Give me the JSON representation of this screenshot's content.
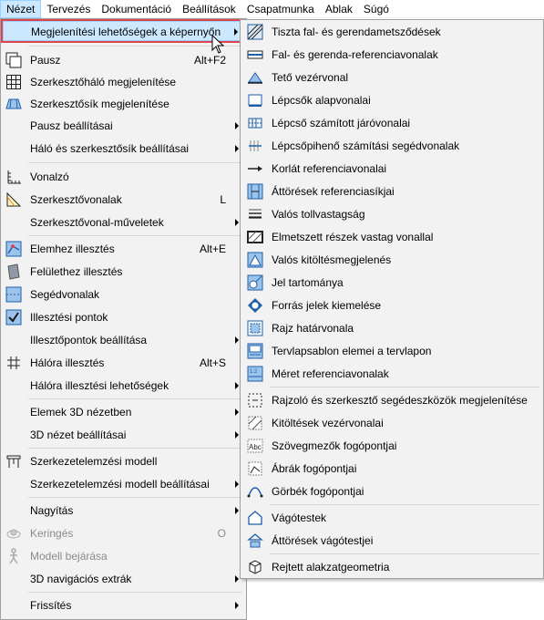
{
  "menubar": {
    "items": [
      "Nézet",
      "Tervezés",
      "Dokumentáció",
      "Beállítások",
      "Csapatmunka",
      "Ablak",
      "Súgó"
    ]
  },
  "left_menu": {
    "items": [
      {
        "label": "Megjelenítési lehetőségek a képernyőn",
        "shortcut": "",
        "submenu": true,
        "icon": "none",
        "state": "highlighted"
      },
      {
        "label": "Pausz",
        "shortcut": "Alt+F2",
        "submenu": false,
        "icon": "trace-icon"
      },
      {
        "label": "Szerkesztőháló megjelenítése",
        "shortcut": "",
        "submenu": false,
        "icon": "grid-icon"
      },
      {
        "label": "Szerkesztősík megjelenítése",
        "shortcut": "",
        "submenu": false,
        "icon": "editing-plane-icon"
      },
      {
        "label": "Pausz beállításai",
        "shortcut": "",
        "submenu": true,
        "icon": "none"
      },
      {
        "label": "Háló és szerkesztősík beállításai",
        "shortcut": "",
        "submenu": true,
        "icon": "none"
      },
      {
        "label": "Vonalzó",
        "shortcut": "",
        "submenu": false,
        "icon": "ruler-icon"
      },
      {
        "label": "Szerkesztővonalak",
        "shortcut": "L",
        "submenu": false,
        "icon": "guide-lines-icon"
      },
      {
        "label": "Szerkesztővonal-műveletek",
        "shortcut": "",
        "submenu": true,
        "icon": "none"
      },
      {
        "label": "Elemhez illesztés",
        "shortcut": "Alt+E",
        "submenu": false,
        "icon": "snap-element-icon"
      },
      {
        "label": "Felülethez illesztés",
        "shortcut": "",
        "submenu": false,
        "icon": "snap-surface-icon"
      },
      {
        "label": "Segédvonalak",
        "shortcut": "",
        "submenu": false,
        "icon": "helper-lines-icon"
      },
      {
        "label": "Illesztési pontok",
        "shortcut": "",
        "submenu": false,
        "icon": "snap-points-icon"
      },
      {
        "label": "Illesztőpontok beállítása",
        "shortcut": "",
        "submenu": true,
        "icon": "none"
      },
      {
        "label": "Hálóra illesztés",
        "shortcut": "Alt+S",
        "submenu": false,
        "icon": "snap-grid-icon"
      },
      {
        "label": "Hálóra illesztési lehetőségek",
        "shortcut": "",
        "submenu": true,
        "icon": "none"
      },
      {
        "label": "Elemek 3D nézetben",
        "shortcut": "",
        "submenu": true,
        "icon": "none"
      },
      {
        "label": "3D nézet beállításai",
        "shortcut": "",
        "submenu": true,
        "icon": "none"
      },
      {
        "label": "Szerkezetelemzési modell",
        "shortcut": "",
        "submenu": false,
        "icon": "structural-model-icon"
      },
      {
        "label": "Szerkezetelemzési modell beállításai",
        "shortcut": "",
        "submenu": true,
        "icon": "none"
      },
      {
        "label": "Nagyítás",
        "shortcut": "",
        "submenu": true,
        "icon": "none"
      },
      {
        "label": "Keringés",
        "shortcut": "O",
        "submenu": false,
        "icon": "orbit-icon",
        "disabled": true
      },
      {
        "label": "Modell bejárása",
        "shortcut": "",
        "submenu": false,
        "icon": "walk-icon",
        "disabled": true
      },
      {
        "label": "3D navigációs extrák",
        "shortcut": "",
        "submenu": true,
        "icon": "none"
      },
      {
        "label": "Frissítés",
        "shortcut": "",
        "submenu": true,
        "icon": "none"
      }
    ]
  },
  "right_menu": {
    "items": [
      {
        "label": "Tiszta fal- és gerendametsződések",
        "icon": "clean-intersections-icon"
      },
      {
        "label": "Fal- és gerenda-referenciavonalak",
        "icon": "reference-lines-icon"
      },
      {
        "label": "Tető vezérvonal",
        "icon": "roof-pivot-icon"
      },
      {
        "label": "Lépcsők alapvonalai",
        "icon": "stair-baseline-icon"
      },
      {
        "label": "Lépcső számított járóvonalai",
        "icon": "stair-walkline-icon"
      },
      {
        "label": "Lépcsőpihenő számítási segédvonalak",
        "icon": "landing-lines-icon"
      },
      {
        "label": "Korlát referenciavonalai",
        "icon": "railing-reference-icon"
      },
      {
        "label": "Áttörések referenciasíkjai",
        "icon": "opening-planes-icon"
      },
      {
        "label": "Valós tollvastagság",
        "icon": "true-pen-icon"
      },
      {
        "label": "Elmetszett részek vastag vonallal",
        "icon": "bold-cut-icon"
      },
      {
        "label": "Valós kitöltésmegjelenés",
        "icon": "vectorial-hatching-icon"
      },
      {
        "label": "Jel tartománya",
        "icon": "marker-range-icon"
      },
      {
        "label": "Forrás jelek kiemelése",
        "icon": "source-marker-icon"
      },
      {
        "label": "Rajz határvonala",
        "icon": "drawing-frame-icon"
      },
      {
        "label": "Tervlapsablon elemei a tervlapon",
        "icon": "master-layout-icon"
      },
      {
        "label": "Méret referenciavonalak",
        "icon": "dimension-reference-icon"
      },
      {
        "label": "Rajzoló és szerkesztő segédeszközök megjelenítése",
        "icon": "drawing-aids-icon"
      },
      {
        "label": "Kitöltések vezérvonalai",
        "icon": "fill-handles-icon"
      },
      {
        "label": "Szövegmezők fogópontjai",
        "icon": "text-box-handles-icon"
      },
      {
        "label": "Ábrák fogópontjai",
        "icon": "figure-handles-icon"
      },
      {
        "label": "Görbék fogópontjai",
        "icon": "spline-handles-icon"
      },
      {
        "label": "Vágótestek",
        "icon": "cutting-body-icon"
      },
      {
        "label": "Áttörések vágótestjei",
        "icon": "opening-cut-icon"
      },
      {
        "label": "Rejtett alakzatgeometria",
        "icon": "hidden-geometry-icon"
      }
    ]
  },
  "colors": {
    "highlight_bg": "#cce8ff",
    "highlight_border": "#99d1ff",
    "focus_outline": "#e0434b",
    "icon_blue": "#1f5fa8",
    "menu_bg": "#f2f2f2"
  }
}
